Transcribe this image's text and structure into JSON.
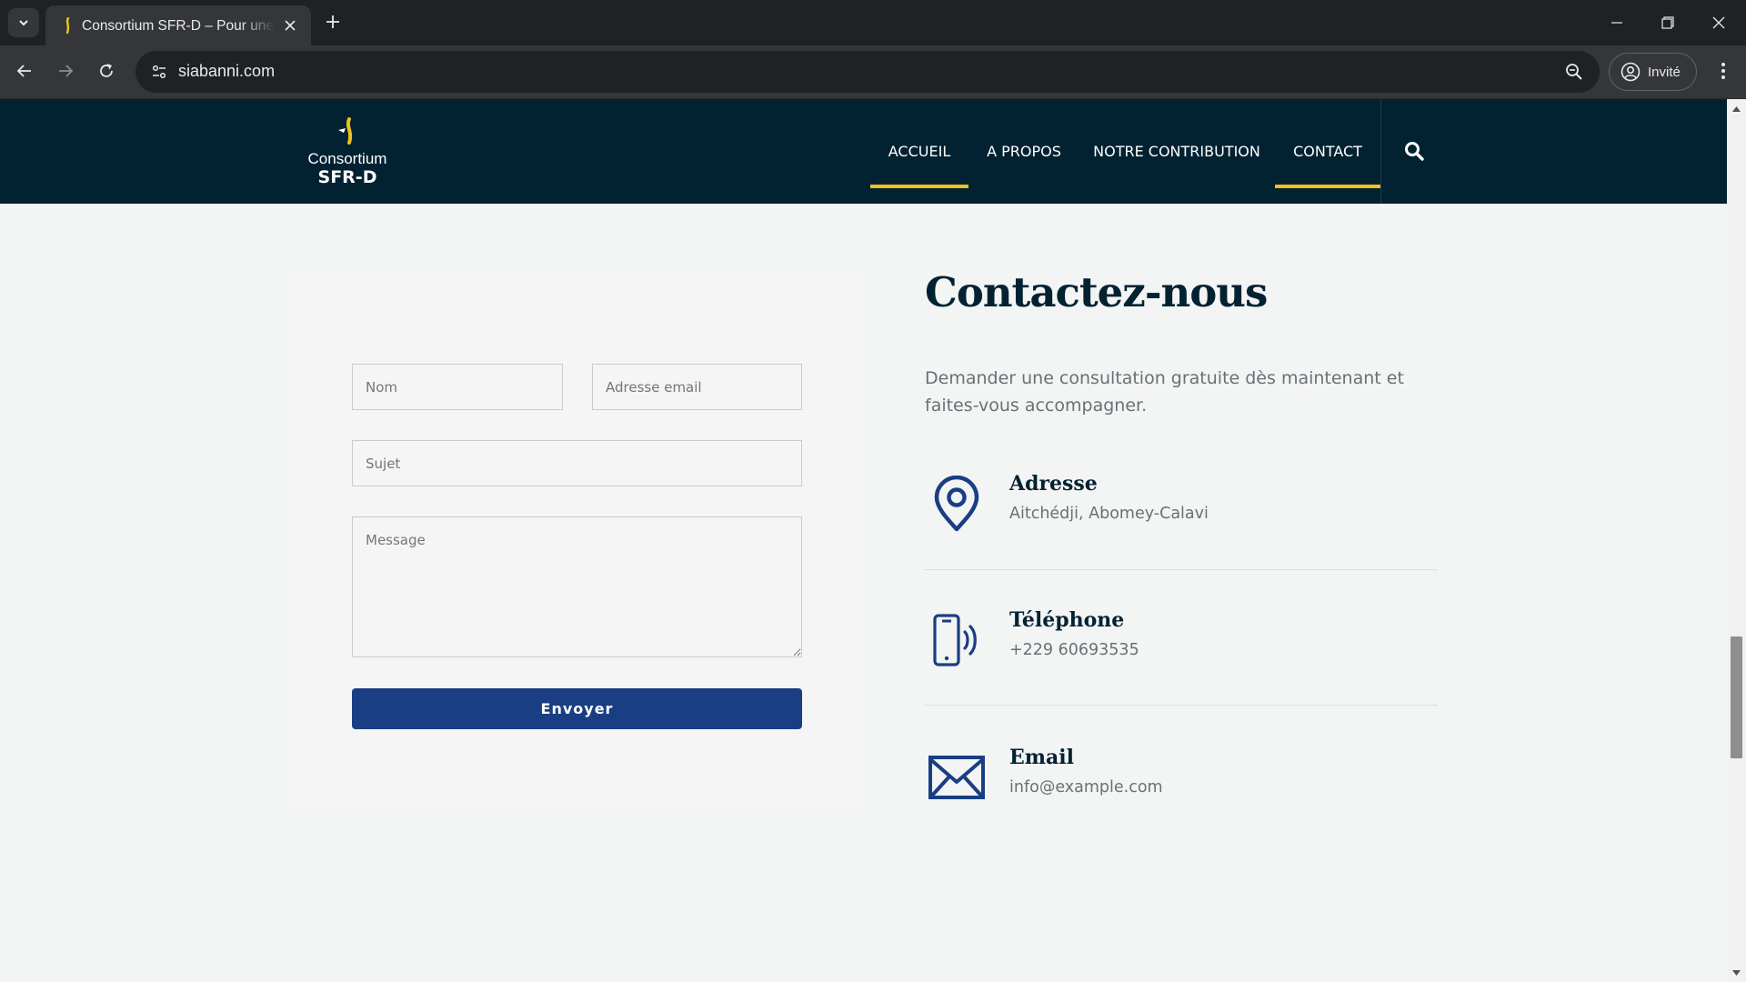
{
  "browser": {
    "tab": {
      "title": "Consortium SFR-D – Pour une é"
    },
    "address_bar": {
      "url": "siabanni.com"
    },
    "profile": {
      "label": "Invité"
    }
  },
  "site": {
    "logo": {
      "line1": "Consortium",
      "line2": "SFR-D"
    },
    "nav": [
      {
        "label": "ACCUEIL",
        "active": true
      },
      {
        "label": "A PROPOS",
        "active": false
      },
      {
        "label": "NOTRE CONTRIBUTION",
        "active": false
      },
      {
        "label": "CONTACT",
        "active": true
      }
    ],
    "colors": {
      "header_bg": "#022232",
      "accent": "#f2c01b",
      "button": "#1a3e84",
      "icon": "#1a3e84"
    }
  },
  "form": {
    "name_placeholder": "Nom",
    "email_placeholder": "Adresse email",
    "subject_placeholder": "Sujet",
    "message_placeholder": "Message",
    "submit_label": "Envoyer"
  },
  "contact": {
    "title": "Contactez-nous",
    "intro": "Demander une consultation gratuite dès maintenant et faites-vous accompagner.",
    "items": [
      {
        "icon": "map-pin-icon",
        "label": "Adresse",
        "value": "Aitchédji, Abomey-Calavi"
      },
      {
        "icon": "phone-icon",
        "label": "Téléphone",
        "value": "+229 60693535"
      },
      {
        "icon": "envelope-icon",
        "label": "Email",
        "value": "info@example.com"
      }
    ]
  }
}
